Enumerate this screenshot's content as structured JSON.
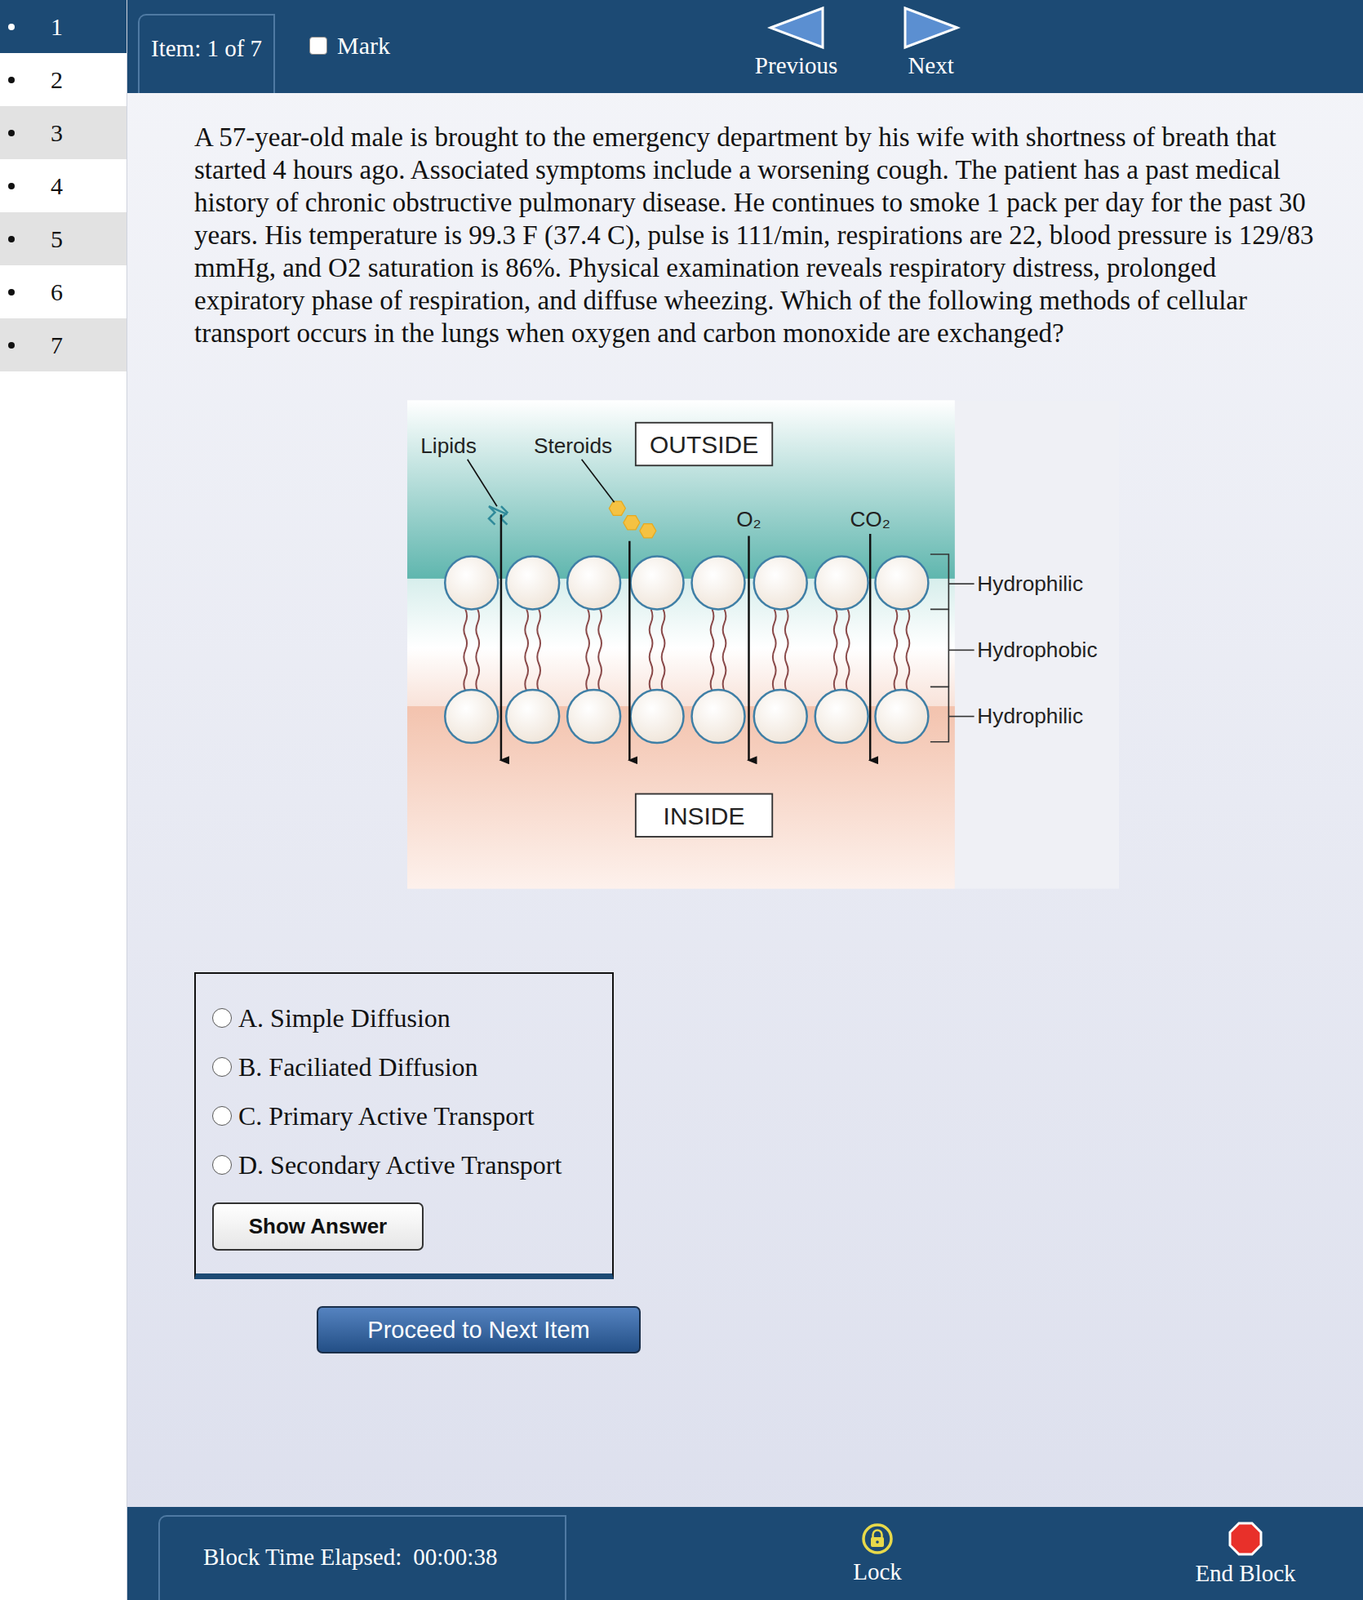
{
  "sidebar": {
    "items": [
      {
        "label": "1",
        "selected": true
      },
      {
        "label": "2",
        "selected": false
      },
      {
        "label": "3",
        "selected": false
      },
      {
        "label": "4",
        "selected": false
      },
      {
        "label": "5",
        "selected": false
      },
      {
        "label": "6",
        "selected": false
      },
      {
        "label": "7",
        "selected": false
      }
    ]
  },
  "header": {
    "item_label": "Item: 1 of 7",
    "mark": {
      "label": "Mark",
      "checked": false
    },
    "previous": "Previous",
    "next": "Next"
  },
  "question": {
    "text": "A 57-year-old male is brought to the emergency department by his wife with shortness of breath that started 4 hours ago. Associated symptoms include a worsening cough. The patient has a past medical history of chronic obstructive pulmonary disease. He continues to smoke 1 pack per day for the past 30 years. His temperature is 99.3 F (37.4 C), pulse is 111/min, respirations are 22, blood pressure is 129/83 mmHg, and O2 saturation is 86%. Physical examination reveals respiratory distress, prolonged expiratory phase of respiration, and diffuse wheezing. Which of the following methods of cellular transport occurs in the lungs when oxygen and carbon monoxide are exchanged?"
  },
  "diagram": {
    "lipids": "Lipids",
    "steroids": "Steroids",
    "outside": "OUTSIDE",
    "inside": "INSIDE",
    "o2": "O₂",
    "co2": "CO₂",
    "layers": [
      "Hydrophilic",
      "Hydrophobic",
      "Hydrophilic"
    ]
  },
  "answers": {
    "options": [
      {
        "label": "A. Simple Diffusion",
        "selected": false
      },
      {
        "label": "B. Faciliated Diffusion",
        "selected": false
      },
      {
        "label": "C. Primary Active Transport",
        "selected": false
      },
      {
        "label": "D. Secondary Active Transport",
        "selected": false
      }
    ],
    "show_answer": "Show Answer"
  },
  "proceed_button": "Proceed to Next Item",
  "footer": {
    "timer_label": "Block Time Elapsed:",
    "timer": "00:00:38",
    "lock": "Lock",
    "end_block": "End Block"
  }
}
